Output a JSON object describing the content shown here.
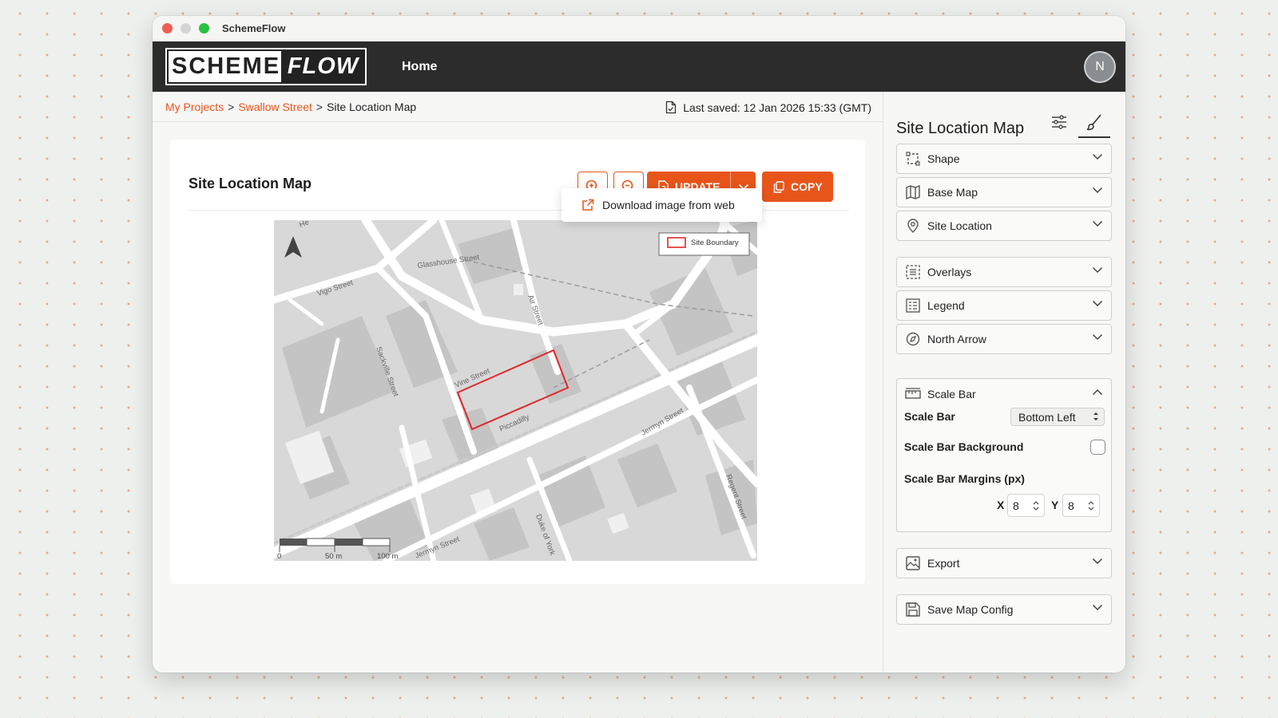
{
  "window": {
    "title": "SchemeFlow"
  },
  "appbar": {
    "logo_left": "SCHEME",
    "logo_right": "FLOW",
    "nav_home": "Home",
    "avatar_initial": "N"
  },
  "breadcrumb": {
    "items": [
      "My Projects",
      "Swallow Street",
      "Site Location Map"
    ],
    "separator": ">"
  },
  "status": {
    "last_saved": "Last saved: 12 Jan 2026 15:33 (GMT)"
  },
  "card": {
    "title": "Site Location Map",
    "update_label": "UPDATE",
    "copy_label": "COPY",
    "dropdown_item": "Download image from web"
  },
  "map": {
    "legend_label": "Site Boundary",
    "streets": {
      "glasshouse": "Glasshouse Street",
      "vigo": "Vigo Street",
      "air": "Air Street",
      "sackville": "Sackville Street",
      "vine": "Vine Street",
      "piccadilly": "Piccadilly",
      "jermyn1": "Jermyn Street",
      "jermyn2": "Jermyn Street",
      "duke": "Duke of York",
      "regent": "Regent Street",
      "he": "He"
    },
    "scale_labels": [
      "0",
      "50 m",
      "100 m"
    ]
  },
  "panel": {
    "title": "Site Location Map",
    "sections": {
      "shape": "Shape",
      "base_map": "Base Map",
      "site_location": "Site Location",
      "overlays": "Overlays",
      "legend": "Legend",
      "north_arrow": "North Arrow",
      "scale_bar": "Scale Bar",
      "export": "Export",
      "save_map_config": "Save Map Config"
    },
    "scale_bar": {
      "position_label": "Scale Bar",
      "position_value": "Bottom Left",
      "background_label": "Scale Bar Background",
      "background_checked": false,
      "margins_label": "Scale Bar Margins (px)",
      "x_label": "X",
      "x_value": "8",
      "y_label": "Y",
      "y_value": "8"
    }
  },
  "colors": {
    "accent": "#e8551b",
    "appbar": "#2c2c2c",
    "site_boundary": "#e0282a"
  }
}
